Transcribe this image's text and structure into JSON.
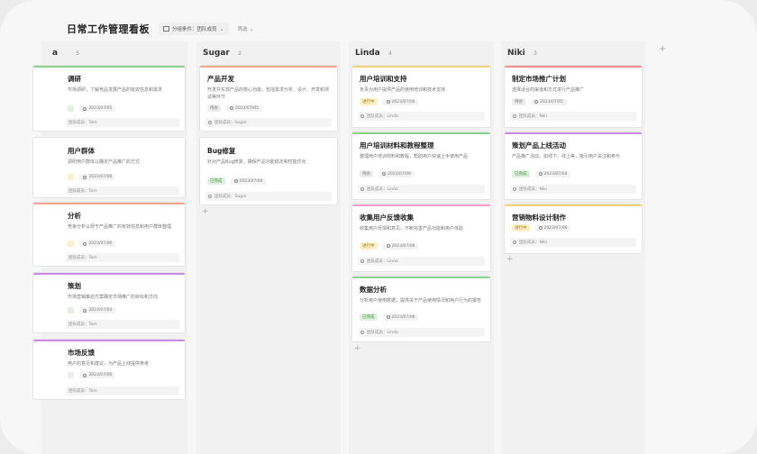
{
  "header": {
    "title": "日常工作管理看板",
    "group_label": "分组条件：团队成员",
    "filter_label": "筛选"
  },
  "columns": [
    {
      "name": "a",
      "count": "5",
      "cards": [
        {
          "title": "调研",
          "desc": "市场调研，了解竞品发展产品的有效信息和需求",
          "tag": "",
          "tag_color": "green",
          "date": "2023/07/05",
          "assignee": "团队成员：Tom",
          "bar": "#8fd28b"
        },
        {
          "title": "用户群体",
          "desc": "调研用户群体以确定产品推广的方式",
          "tag": "",
          "tag_color": "yellow",
          "date": "2023/07/06",
          "assignee": "团队成员：Tom",
          "bar": ""
        },
        {
          "title": "分析",
          "desc": "竞争分析以便于产品推广的有效信息和用户群体整理",
          "tag": "",
          "tag_color": "yellow",
          "date": "2023/07/06",
          "assignee": "团队成员：Tom",
          "bar": "#f0a58c"
        },
        {
          "title": "策划",
          "desc": "市场营销策划方案确定市场推广的目标和方向",
          "tag": "",
          "tag_color": "green",
          "date": "2023/07/04",
          "assignee": "团队成员：Tom",
          "bar": "#c98ce0"
        },
        {
          "title": "市场反馈",
          "desc": "用户的意见和建议，为产品上线提供参考",
          "tag": "",
          "tag_color": "gray",
          "date": "2023/07/06",
          "assignee": "团队成员：Tom",
          "bar": "#c98ce0"
        }
      ]
    },
    {
      "name": "Sugar",
      "count": "2",
      "cards": [
        {
          "title": "产品开发",
          "desc": "开发并实现产品的核心功能，包括需求分析、设计、开发和测试等环节",
          "tag": "待办",
          "tag_color": "gray",
          "date": "2023/07/05",
          "assignee": "团队成员：Sugar",
          "bar": "#f0a58c"
        },
        {
          "title": "Bug修复",
          "desc": "针对产品Bug修复，确保产品功能稳定和性能优化",
          "tag": "已完成",
          "tag_color": "green",
          "date": "2023/07/04",
          "assignee": "团队成员：Sugar",
          "bar": ""
        }
      ]
    },
    {
      "name": "Linda",
      "count": "4",
      "cards": [
        {
          "title": "用户培训和支持",
          "desc": "负责为用户提供产品的使用培训和技术支持",
          "tag": "进行中",
          "tag_color": "yellow",
          "date": "2023/07/06",
          "assignee": "团队成员：Linda",
          "bar": "#f4d27a"
        },
        {
          "title": "用户培训材料和教程整理",
          "desc": "整理用户培训材料和教程，帮助用户快速上手使用产品",
          "tag": "待办",
          "tag_color": "gray",
          "date": "2023/07/06",
          "assignee": "团队成员：Linda",
          "bar": "#8fd28b"
        },
        {
          "title": "收集用户反馈收集",
          "desc": "收集用户反馈和意见，不断完善产品功能和用户体验",
          "tag": "进行中",
          "tag_color": "yellow",
          "date": "2023/07/06",
          "assignee": "团队成员：Linda",
          "bar": "#f2a0c8"
        },
        {
          "title": "数据分析",
          "desc": "分析用户使用数据，提供关于产品使用情况和用户行为的报告",
          "tag": "已完成",
          "tag_color": "green",
          "date": "2023/07/06",
          "assignee": "团队成员：Linda",
          "bar": "#8fd28b"
        }
      ]
    },
    {
      "name": "Niki",
      "count": "3",
      "cards": [
        {
          "title": "制定市场推广计划",
          "desc": "选择适合的渠道和方式进行产品推广",
          "tag": "待办",
          "tag_color": "gray",
          "date": "2023/07/05",
          "assignee": "团队成员：Niki",
          "bar": "#f08c8c"
        },
        {
          "title": "策划产品上线活动",
          "desc": "产品推广活动，如线下、线上等，吸引用户关注和参与",
          "tag": "已完成",
          "tag_color": "green",
          "date": "2023/07/04",
          "assignee": "团队成员：Niki",
          "bar": "#c98ce0"
        },
        {
          "title": "营销物料设计制作",
          "desc": "",
          "tag": "进行中",
          "tag_color": "yellow",
          "date": "2023/07/06",
          "assignee": "团队成员：Niki",
          "bar": "#f4d27a"
        }
      ]
    }
  ],
  "add_symbol": "+"
}
